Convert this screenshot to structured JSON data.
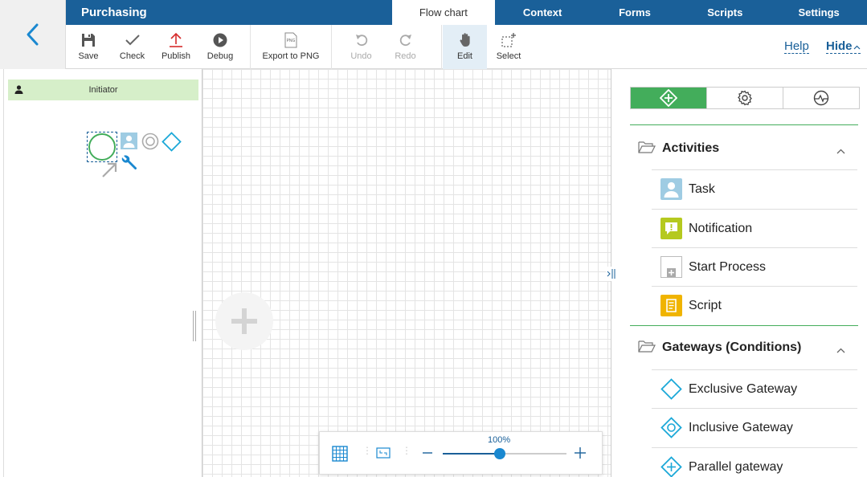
{
  "app": {
    "title": "Purchasing"
  },
  "nav": {
    "tabs": [
      {
        "label": "Flow chart",
        "active": true
      },
      {
        "label": "Context",
        "active": false
      },
      {
        "label": "Forms",
        "active": false
      },
      {
        "label": "Scripts",
        "active": false
      },
      {
        "label": "Settings",
        "active": false
      }
    ]
  },
  "toolbar": {
    "save": "Save",
    "check": "Check",
    "publish": "Publish",
    "debug": "Debug",
    "export": "Export to PNG",
    "export_icon_text": "PNG",
    "undo": "Undo",
    "redo": "Redo",
    "edit": "Edit",
    "select": "Select",
    "help": "Help",
    "hide": "Hide"
  },
  "lane": {
    "name": "Initiator"
  },
  "zoom": {
    "label": "100%",
    "level": 0.46
  },
  "palette": {
    "sections": [
      {
        "title": "Activities",
        "items": [
          {
            "label": "Task",
            "icon": "task-icon"
          },
          {
            "label": "Notification",
            "icon": "notification-icon"
          },
          {
            "label": "Start Process",
            "icon": "start-process-icon"
          },
          {
            "label": "Script",
            "icon": "script-icon"
          }
        ]
      },
      {
        "title": "Gateways (Conditions)",
        "items": [
          {
            "label": "Exclusive Gateway",
            "icon": "exclusive-gateway-icon"
          },
          {
            "label": "Inclusive Gateway",
            "icon": "inclusive-gateway-icon"
          },
          {
            "label": "Parallel gateway",
            "icon": "parallel-gateway-icon"
          }
        ]
      }
    ]
  },
  "colors": {
    "nav": "#1a6099",
    "accent_green": "#43ad5b",
    "lane_header": "#d6efc9",
    "link": "#1a6099",
    "gateway": "#1ba8d8",
    "task_icon": "#9fcce3",
    "notification_icon": "#b5c91f",
    "script_icon": "#f0b400"
  }
}
